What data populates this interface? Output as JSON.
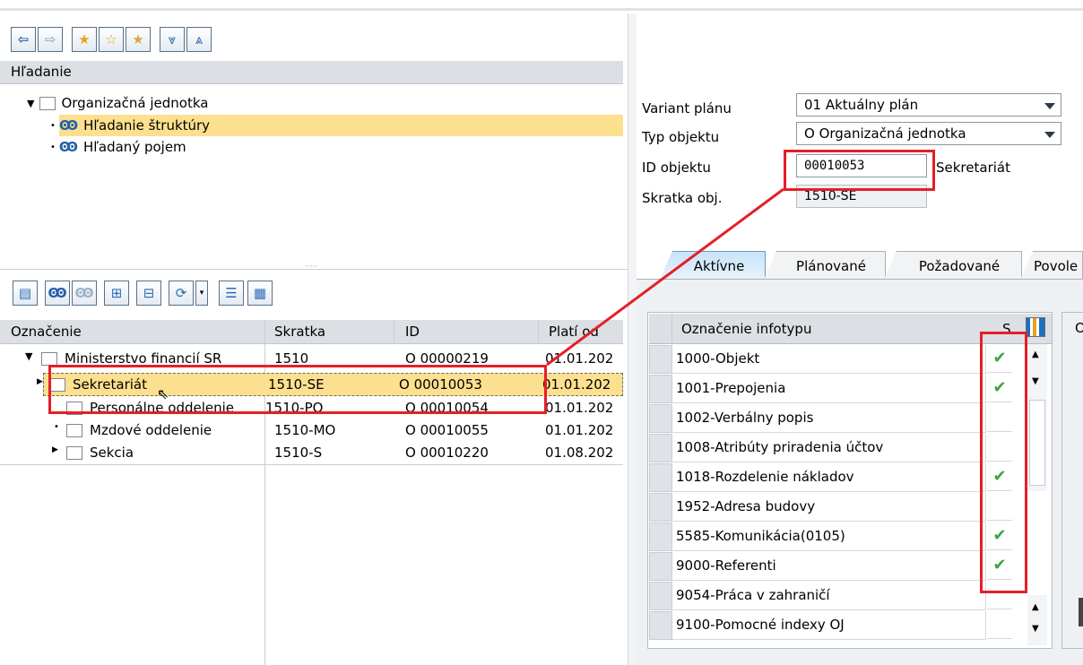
{
  "search_panel": {
    "title": "Hľadanie",
    "root": "Organizačná jednotka",
    "items": [
      "Hľadanie štruktúry",
      "Hľadaný pojem"
    ]
  },
  "splitter_grip": "·····",
  "structure": {
    "columns": [
      "Označenie",
      "Skratka",
      "ID",
      "Platí od"
    ],
    "rows": [
      {
        "label": "Ministerstvo financií SR",
        "abbr": "1510",
        "id": "O  00000219",
        "valid": "01.01.202"
      },
      {
        "label": "Sekretariát",
        "abbr": "1510-SE",
        "id": "O  00010053",
        "valid": "01.01.202"
      },
      {
        "label": "Personálne oddelenie",
        "abbr": "1510-PO",
        "id": "O  00010054",
        "valid": "01.01.202"
      },
      {
        "label": "Mzdové oddelenie",
        "abbr": "1510-MO",
        "id": "O  00010055",
        "valid": "01.01.202"
      },
      {
        "label": "Sekcia",
        "abbr": "1510-S",
        "id": "O  00010220",
        "valid": "01.08.202"
      }
    ]
  },
  "header_form": {
    "plan_variant": {
      "label": "Variant plánu",
      "value": "01 Aktuálny plán"
    },
    "object_type": {
      "label": "Typ objektu",
      "value": "O Organizačná jednotka"
    },
    "object_id": {
      "label": "ID objektu",
      "value": "00010053",
      "name": "Sekretariát"
    },
    "object_abbr": {
      "label": "Skratka obj.",
      "value": "1510-SE"
    }
  },
  "tabs": [
    "Aktívne",
    "Plánované",
    "Požadované",
    "Povole"
  ],
  "infotypes": {
    "col_name": "Označenie infotypu",
    "col_s": "S",
    "next_col": "O",
    "rows": [
      {
        "name": "1000-Objekt",
        "s": "✔"
      },
      {
        "name": "1001-Prepojenia",
        "s": "✔"
      },
      {
        "name": "1002-Verbálny popis",
        "s": ""
      },
      {
        "name": "1008-Atribúty priradenia účtov",
        "s": ""
      },
      {
        "name": "1018-Rozdelenie nákladov",
        "s": "✔"
      },
      {
        "name": "1952-Adresa budovy",
        "s": ""
      },
      {
        "name": "5585-Komunikácia(0105)",
        "s": "✔"
      },
      {
        "name": "9000-Referenti",
        "s": "✔"
      },
      {
        "name": "9054-Práca v zahraničí",
        "s": ""
      },
      {
        "name": "9100-Pomocné indexy OJ",
        "s": ""
      }
    ]
  },
  "colors": {
    "highlight": "#fce08f",
    "annotation_red": "#e51f27",
    "check_green": "#3aa63a"
  }
}
